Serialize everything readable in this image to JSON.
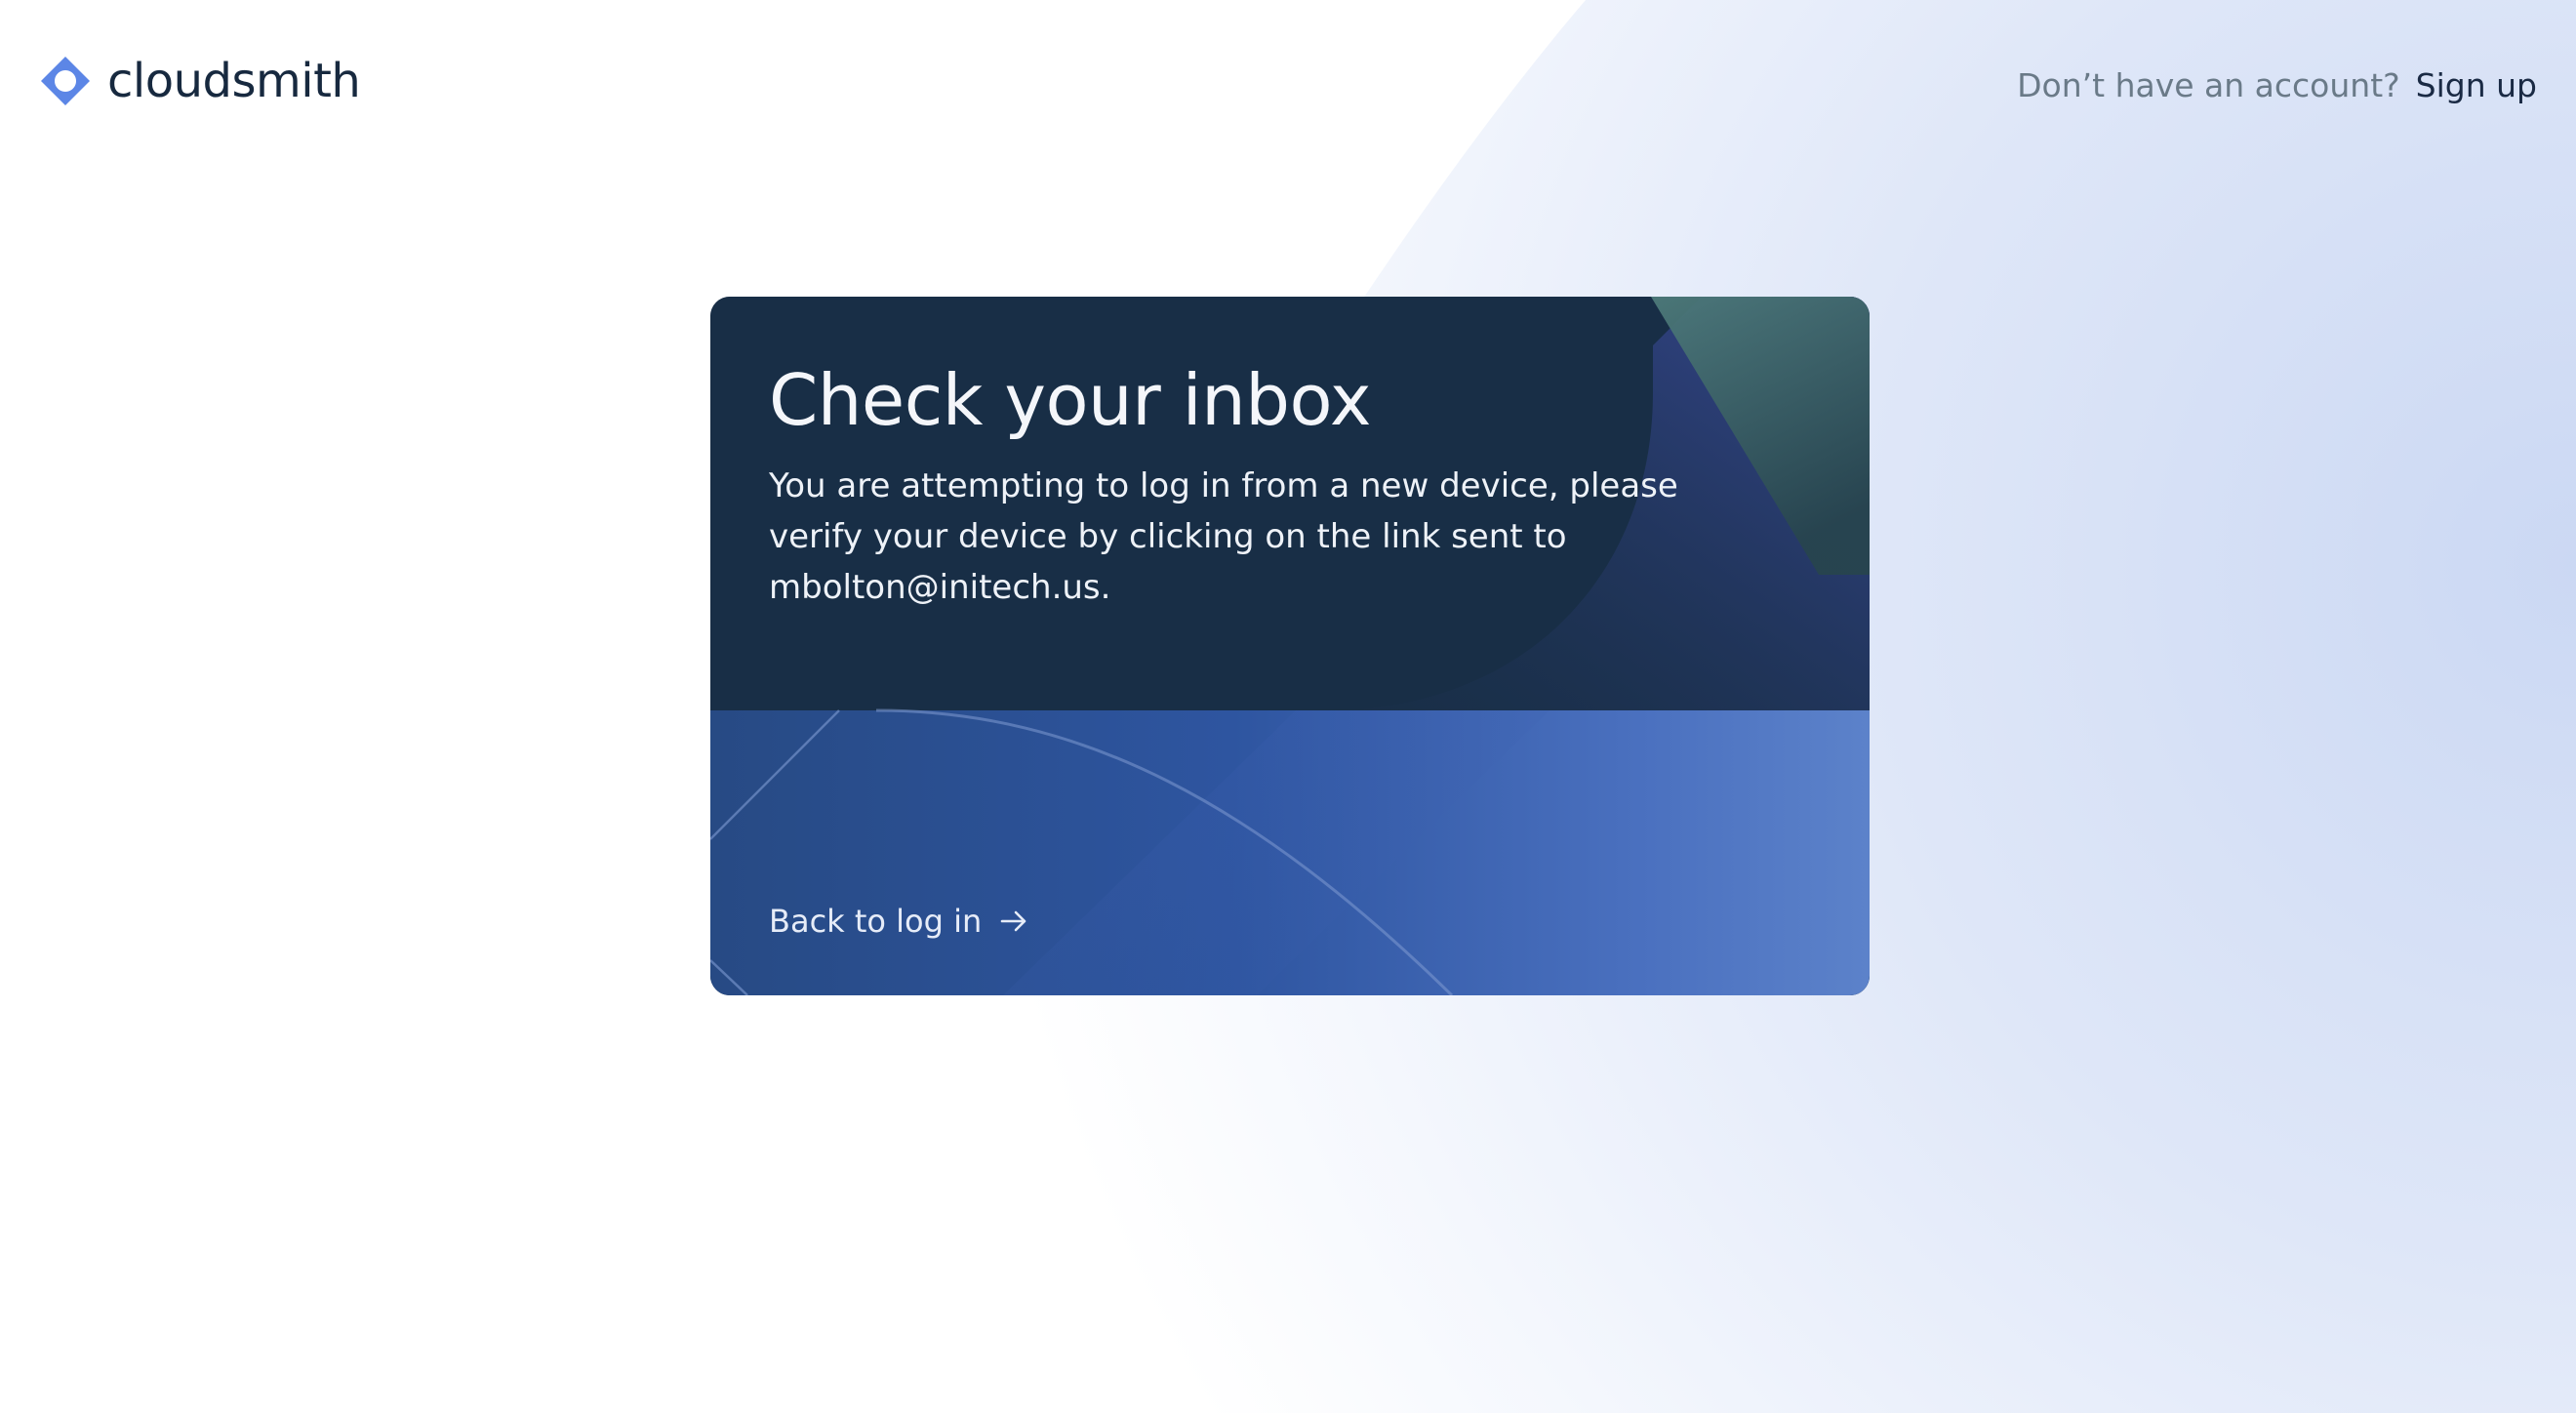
{
  "brand": {
    "name": "cloudsmith",
    "logo_icon": "cloudsmith-logo-icon",
    "colors": {
      "logo_blue": "#5c86e6",
      "text_dark": "#17293f",
      "card_dark": "#182e46",
      "card_blue": "#2c54a0",
      "background_tint": "#d0dcf4"
    }
  },
  "header": {
    "signup_prompt": "Don’t have an account?",
    "signup_link": "Sign up"
  },
  "card": {
    "title": "Check your inbox",
    "body": "You are attempting to log in from a new device, please verify your device by clicking on the link sent to mbolton@initech.us.",
    "back_link": "Back to log in",
    "back_icon": "arrow-right-icon"
  }
}
